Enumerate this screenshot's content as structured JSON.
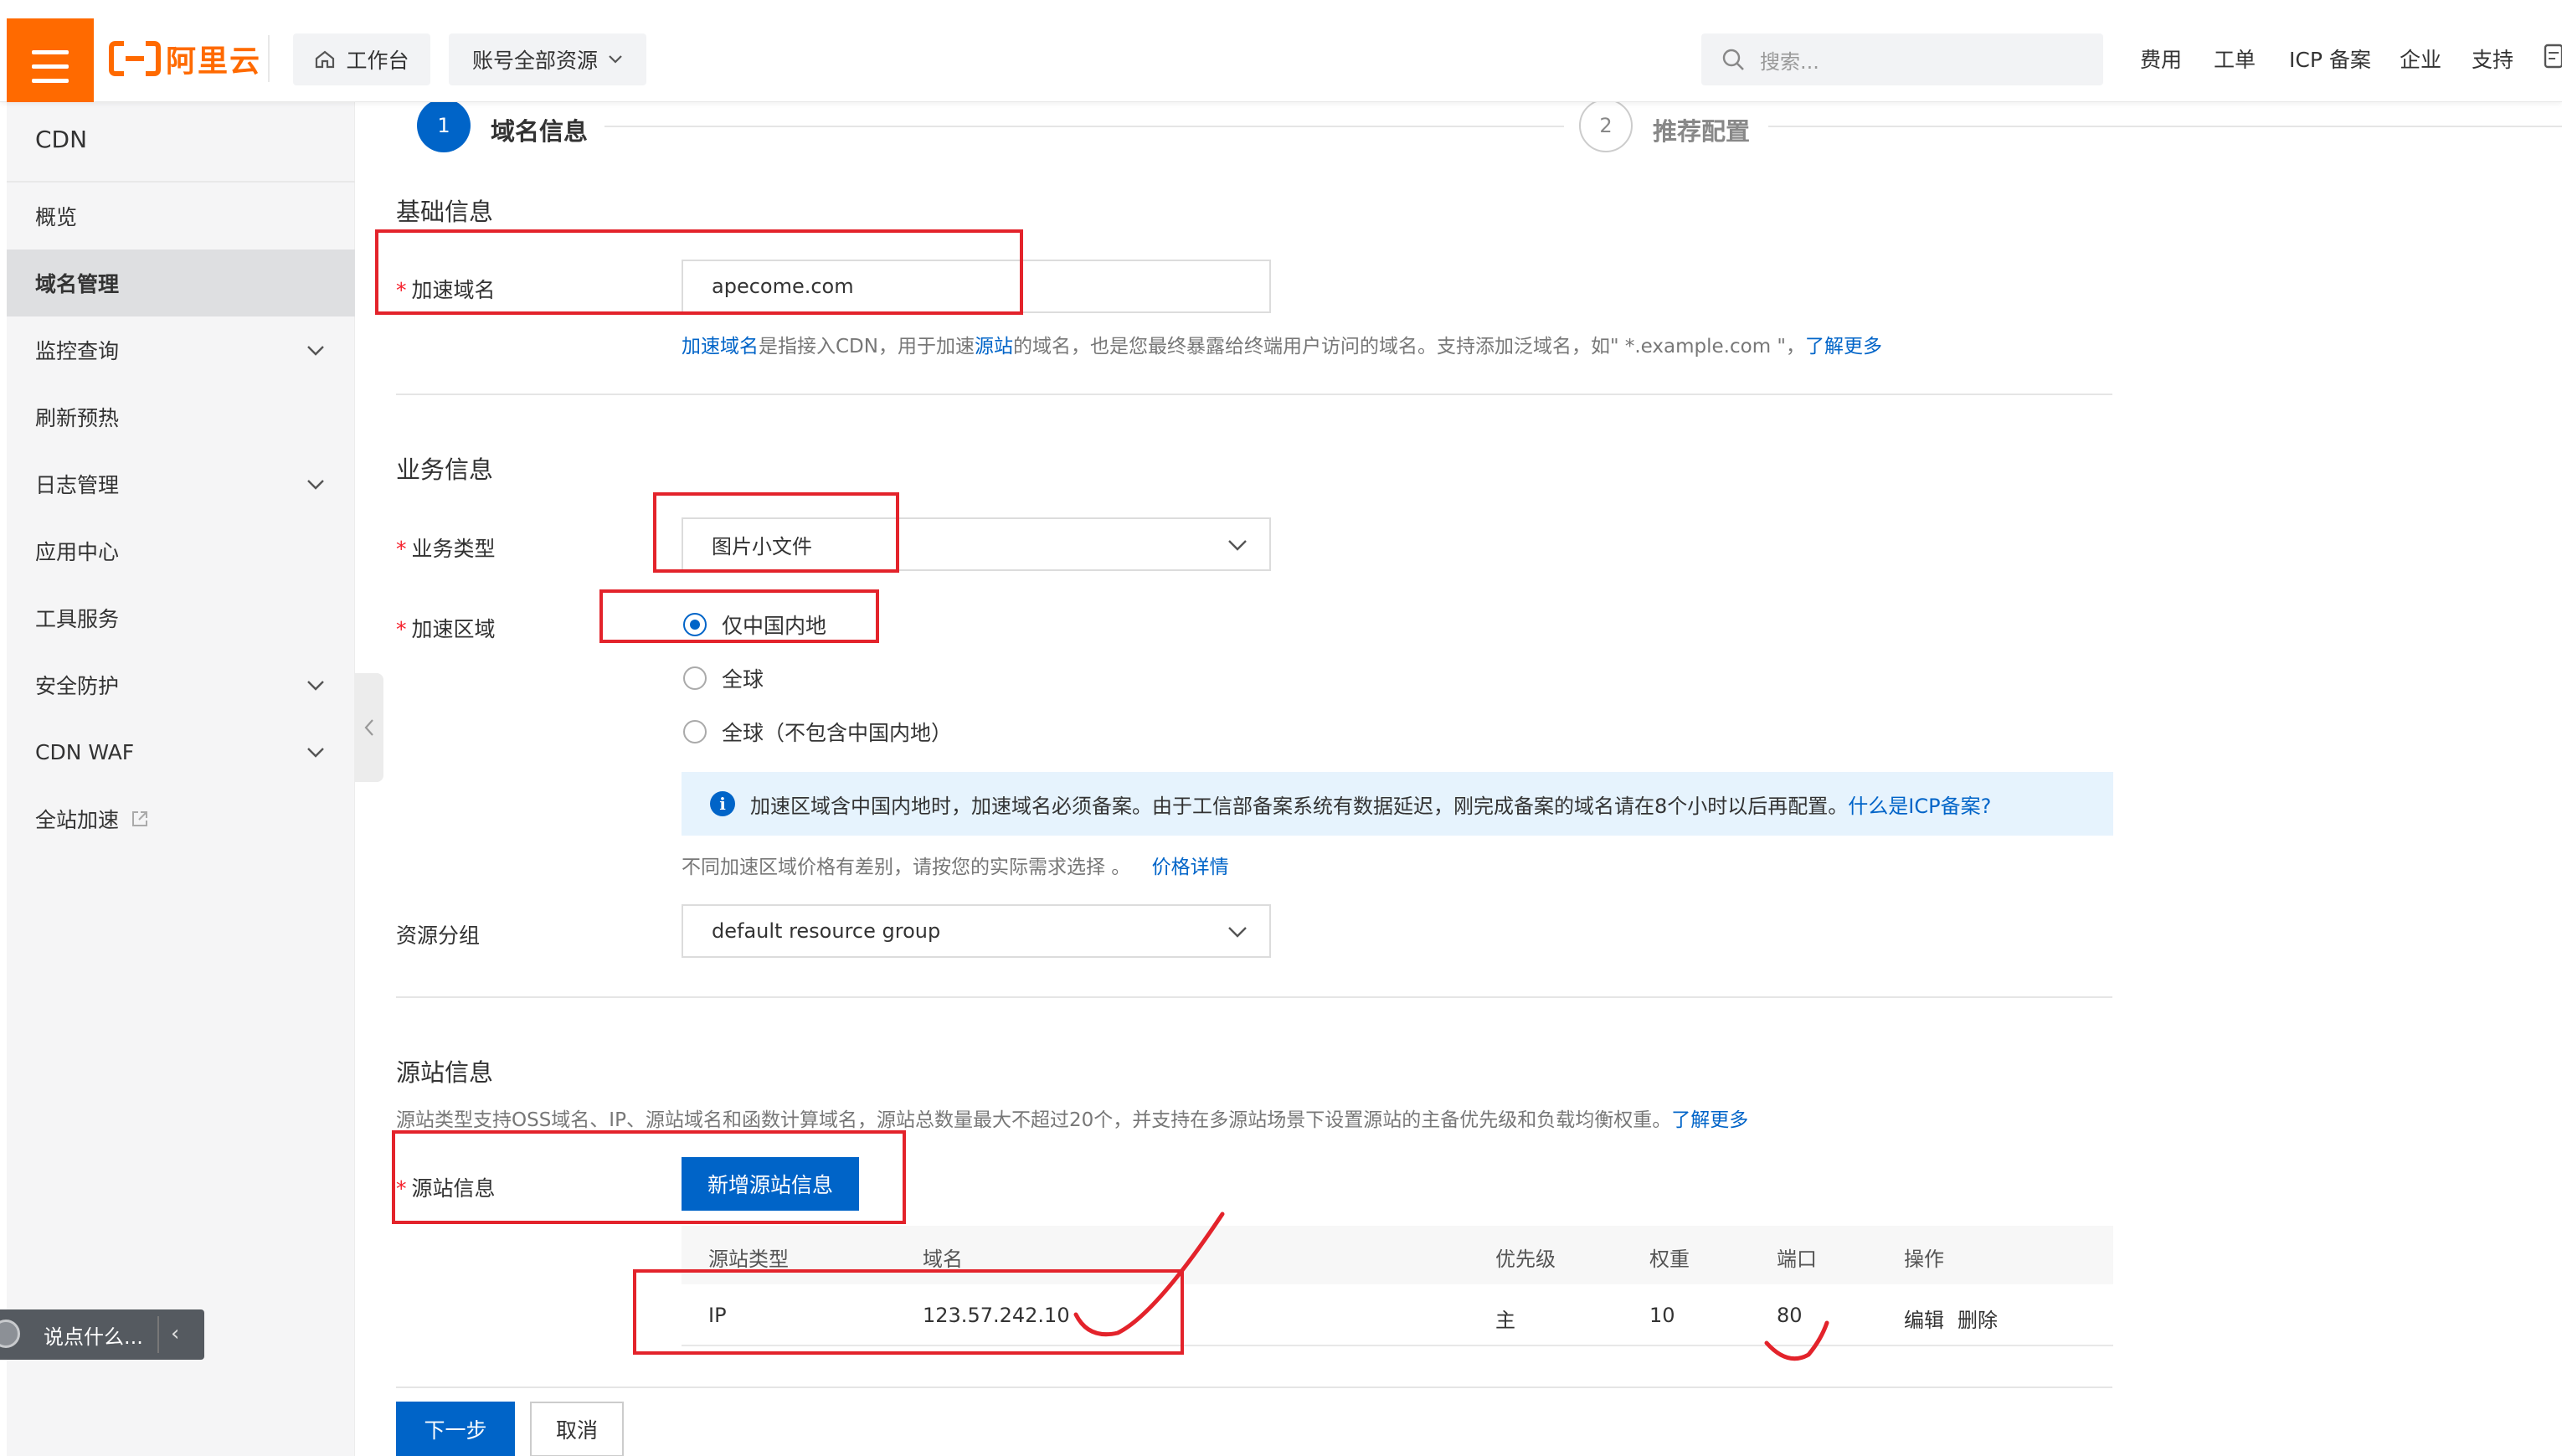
{
  "header": {
    "brand": "阿里云",
    "workbench": "工作台",
    "resources": "账号全部资源",
    "search_placeholder": "搜索...",
    "nav": [
      "费用",
      "工单",
      "ICP 备案",
      "企业",
      "支持"
    ]
  },
  "sidebar": {
    "title": "CDN",
    "items": [
      {
        "label": "概览"
      },
      {
        "label": "域名管理",
        "active": true
      },
      {
        "label": "监控查询",
        "expandable": true
      },
      {
        "label": "刷新预热"
      },
      {
        "label": "日志管理",
        "expandable": true
      },
      {
        "label": "应用中心"
      },
      {
        "label": "工具服务"
      },
      {
        "label": "安全防护",
        "expandable": true
      },
      {
        "label": "CDN WAF",
        "expandable": true
      },
      {
        "label": "全站加速",
        "external": true
      }
    ],
    "feedback": "说点什么..."
  },
  "steps": [
    {
      "num": "1",
      "label": "域名信息",
      "active": true
    },
    {
      "num": "2",
      "label": "推荐配置",
      "active": false
    }
  ],
  "basic": {
    "title": "基础信息",
    "domain_label": "加速域名",
    "domain_value": "apecome.com",
    "help_link1": "加速域名",
    "help_text1": "是指接入CDN，用于加速",
    "help_link2": "源站",
    "help_text2": "的域名，也是您最终暴露给终端用户访问的域名。支持添加泛域名，如\" *.example.com \"，",
    "help_link3": "了解更多"
  },
  "business": {
    "title": "业务信息",
    "type_label": "业务类型",
    "type_value": "图片小文件",
    "region_label": "加速区域",
    "regions": [
      "仅中国内地",
      "全球",
      "全球（不包含中国内地）"
    ],
    "selected_region_index": 0,
    "notice_text": "加速区域含中国内地时，加速域名必须备案。由于工信部备案系统有数据延迟，刚完成备案的域名请在8个小时以后再配置。",
    "notice_link": "什么是ICP备案?",
    "price_text": "不同加速区域价格有差别，请按您的实际需求选择 。",
    "price_link": "价格详情",
    "group_label": "资源分组",
    "group_value": "default resource group"
  },
  "origin": {
    "title": "源站信息",
    "desc": "源站类型支持OSS域名、IP、源站域名和函数计算域名，源站总数量最大不超过20个，并支持在多源站场景下设置源站的主备优先级和负载均衡权重。",
    "desc_link": "了解更多",
    "label": "源站信息",
    "add_button": "新增源站信息",
    "columns": [
      "源站类型",
      "域名",
      "优先级",
      "权重",
      "端口",
      "操作"
    ],
    "rows": [
      {
        "type": "IP",
        "domain": "123.57.242.10",
        "priority": "主",
        "weight": "10",
        "port": "80",
        "edit": "编辑",
        "delete": "删除"
      }
    ]
  },
  "footer": {
    "next": "下一步",
    "cancel": "取消"
  },
  "colors": {
    "brand": "#ff6a00",
    "primary": "#0064c8",
    "annotation": "#e3232b",
    "required": "#f5222d"
  }
}
